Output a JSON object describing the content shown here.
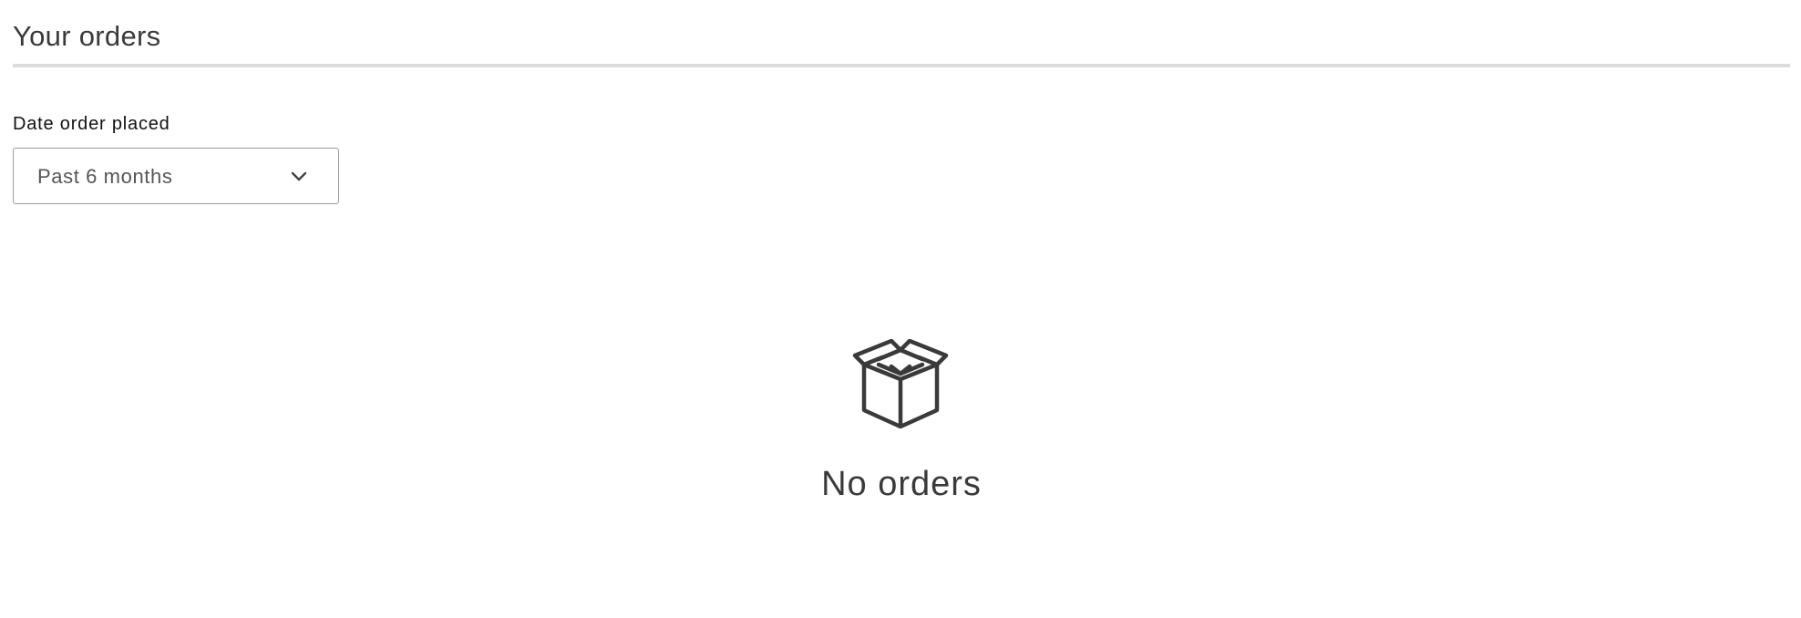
{
  "header": {
    "title": "Your orders"
  },
  "filter": {
    "label": "Date order placed",
    "selected": "Past 6 months"
  },
  "empty_state": {
    "icon": "open-box-icon",
    "message": "No orders"
  },
  "colors": {
    "text": "#333333",
    "divider": "#dcdcdc",
    "border": "#9a9a9a",
    "background": "#ffffff"
  }
}
